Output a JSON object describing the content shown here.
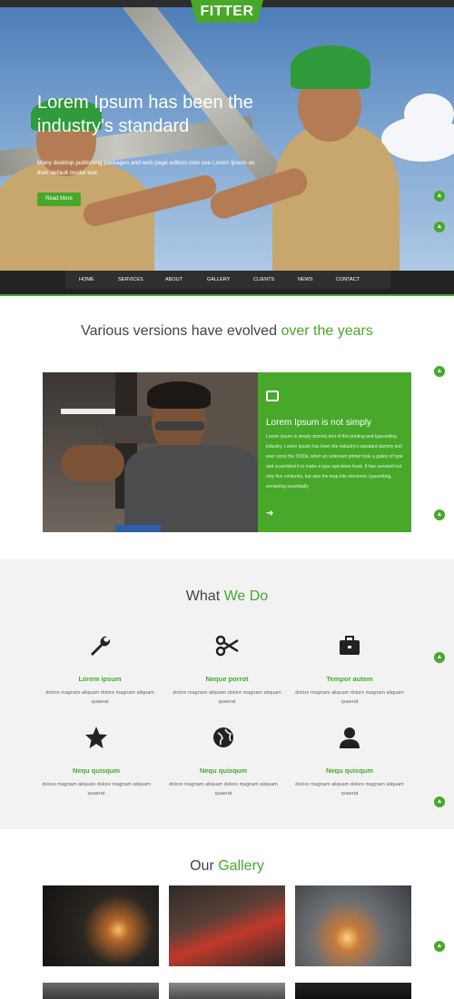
{
  "brand": {
    "logo": "FITTER",
    "accent": "#47a82a"
  },
  "hero": {
    "heading": "Lorem Ipsum has been the industry's standard",
    "text": "Many desktop publishing packages and web page editors now use Lorem Ipsum as their default model text.",
    "button": "Read More"
  },
  "nav": [
    "HOME",
    "SERVICES",
    "ABOUT",
    "GALLERY",
    "CLIENTS",
    "NEWS",
    "CONTACT"
  ],
  "versions": {
    "title_plain": "Various versions have evolved",
    "title_green": "over the years",
    "card_title": "Lorem Ipsum is not simply",
    "card_text": "Lorem Ipsum is simply dummy text of the printing and typesetting industry. Lorem Ipsum has been the industry's standard dummy text ever since the 1500s, when an unknown printer took a galley of type and scrambled it to make a type specimen book. It has survived not only five centuries, but also the leap into electronic typesetting, remaining essentially"
  },
  "whatwedo": {
    "title_plain": "What",
    "title_green": "We Do",
    "services": [
      {
        "icon": "wrench-icon",
        "title": "Lorem ipsum",
        "text": "dolore magnam aliquam dolore magnam aliquam quaerat"
      },
      {
        "icon": "scissors-icon",
        "title": "Neque porrot",
        "text": "dolore magnam aliquam dolore magnam aliquam quaerat"
      },
      {
        "icon": "briefcase-icon",
        "title": "Tempor autem",
        "text": "dolore magnam aliquam dolore magnam aliquam quaerat"
      },
      {
        "icon": "star-icon",
        "title": "Nequ quisqum",
        "text": "dolore magnam aliquam dolore magnam aliquam quaerat"
      },
      {
        "icon": "globe-icon",
        "title": "Nequ quisqum",
        "text": "dolore magnam aliquam dolore magnam aliquam quaerat"
      },
      {
        "icon": "user-icon",
        "title": "Nequ quisqum",
        "text": "dolore magnam aliquam dolore magnam aliquam quaerat"
      }
    ]
  },
  "gallery": {
    "title_plain": "Our",
    "title_green": "Gallery"
  }
}
